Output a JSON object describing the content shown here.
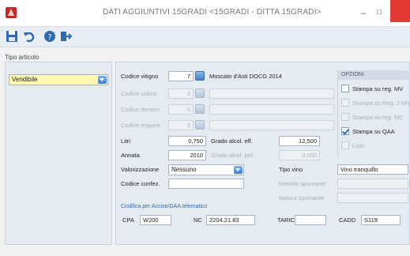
{
  "window": {
    "title": "DATI AGGIUNTIVI 15GRADI <15GRADI - DITTA 15GRADI>",
    "minimize_glyph": "–",
    "maximize_glyph": "□",
    "icons": {
      "app": "app-icon",
      "save": "save-icon",
      "undo": "undo-icon",
      "help": "help-icon",
      "exit": "exit-icon"
    }
  },
  "left": {
    "label": "Tipo articolo",
    "tipo_articolo_value": "Vendibile"
  },
  "form": {
    "codice_vitigno_label": "Codice vitigno",
    "codice_vitigno_value": "7",
    "vitigno_desc": "Moscato d'Asti DOCG 2014",
    "codice_colore_label": "Codice colore",
    "codice_colore_value": "0",
    "codice_denom_label": "Codice denom.",
    "codice_denom_value": "0",
    "codice_regione_label": "Codice regione",
    "codice_regione_value": "0",
    "litri_label": "Litri",
    "litri_value": "0,750",
    "grado_alcol_eff_label": "Grado alcol. eff.",
    "grado_alcol_eff_value": "12,500",
    "annata_label": "Annata",
    "annata_value": "2010",
    "grado_alcol_pot_label": "Grado alcol. pot.",
    "grado_alcol_pot_value": "0,000",
    "valorizzazione_label": "Valorizzazione",
    "valorizzazione_value": "Nessuno",
    "tipo_vino_label": "Tipo vino",
    "tipo_vino_value": "Vino tranquillo",
    "codice_confez_label": "Codice confez.",
    "codice_confez_value": "",
    "metodo_spumante_label": "Metodo spumante",
    "natura_spumante_label": "Natura spumante"
  },
  "opzioni": {
    "header": "OPZIONI",
    "items": [
      {
        "label": "Stampa su reg. MV",
        "checked": false,
        "enabled": true
      },
      {
        "label": "Stampa su Reg. J MV",
        "checked": false,
        "enabled": false
      },
      {
        "label": "Stampa su reg. MC",
        "checked": false,
        "enabled": false
      },
      {
        "label": "Stampa su QAA",
        "checked": true,
        "enabled": true
      },
      {
        "label": "Liste",
        "checked": false,
        "enabled": false
      }
    ]
  },
  "codifica": {
    "header": "Codifica per Accise/DAA telematico",
    "cpa_label": "CPA",
    "cpa_value": "W200",
    "nc_label": "NC",
    "nc_value": "2204.21.83",
    "taric_label": "TARIC",
    "taric_value": "",
    "cadd_label": "CADD",
    "cadd_value": "S119"
  }
}
